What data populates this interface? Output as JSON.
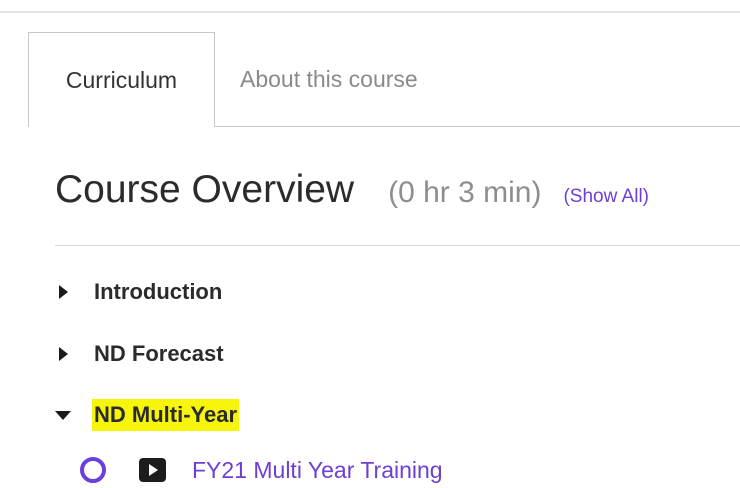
{
  "tabs": [
    {
      "label": "Curriculum",
      "active": true
    },
    {
      "label": "About this course",
      "active": false
    }
  ],
  "overview": {
    "title": "Course Overview",
    "duration": "(0 hr 3 min)",
    "show_all_label": "(Show All)"
  },
  "sections": [
    {
      "label": "Introduction",
      "expanded": false,
      "highlighted": false
    },
    {
      "label": "ND Forecast",
      "expanded": false,
      "highlighted": false
    },
    {
      "label": "ND Multi-Year",
      "expanded": true,
      "highlighted": true
    }
  ],
  "lessons": [
    {
      "title": "FY21 Multi Year Training",
      "type_icon": "video-play-icon",
      "status_icon": "progress-ring-icon"
    }
  ],
  "colors": {
    "accent": "#6d3fd7",
    "highlight": "#f7f50a"
  }
}
